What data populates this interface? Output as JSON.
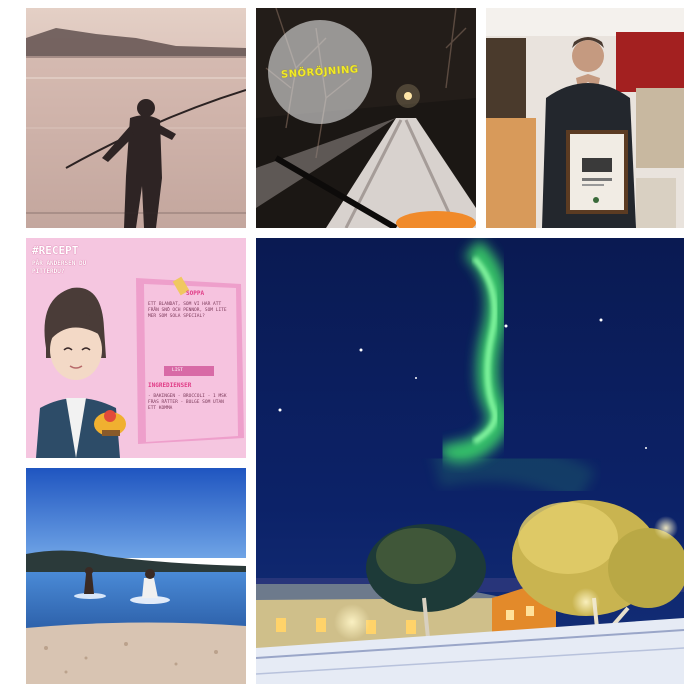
{
  "grid": {
    "tiles": [
      {
        "key": "fisher",
        "icon": "photo-fishing-at-sunset"
      },
      {
        "key": "snow",
        "icon": "photo-snowy-road-at-night",
        "badge_text": "SNÖRÖJNING"
      },
      {
        "key": "award",
        "icon": "photo-man-holding-certificate"
      },
      {
        "key": "recipe",
        "icon": "graphic-recipe-illustration"
      },
      {
        "key": "aurora",
        "icon": "photo-northern-lights-over-village"
      },
      {
        "key": "swim",
        "icon": "photo-swimmers-in-lake"
      }
    ]
  },
  "recipe": {
    "hashtag": "#RECEPT",
    "subtitle": "PÅR ANDERSEN DU PITTERDU?",
    "soup_heading": "SOPPA",
    "soup_text": "ETT BLANDAT, SOM VI HAR ATT FRÅN SNÖ OCH PENNOR, SOM LITE MER SOM SOLA SPECIAL?",
    "ingredients_label": "LIST",
    "ingredients_heading": "INGREDIENSER",
    "ingredients_text": "- BAKINGEN - BROCCOLI - 1 MSK FRAS RÄTTER - BULGE SOM UTAN ETT KOMMA"
  },
  "colors": {
    "aurora_green": "#3dde6a",
    "sky_navy": "#0c1f5e",
    "recipe_pink": "#f0b8d8",
    "building_orange": "#e38a2a"
  }
}
